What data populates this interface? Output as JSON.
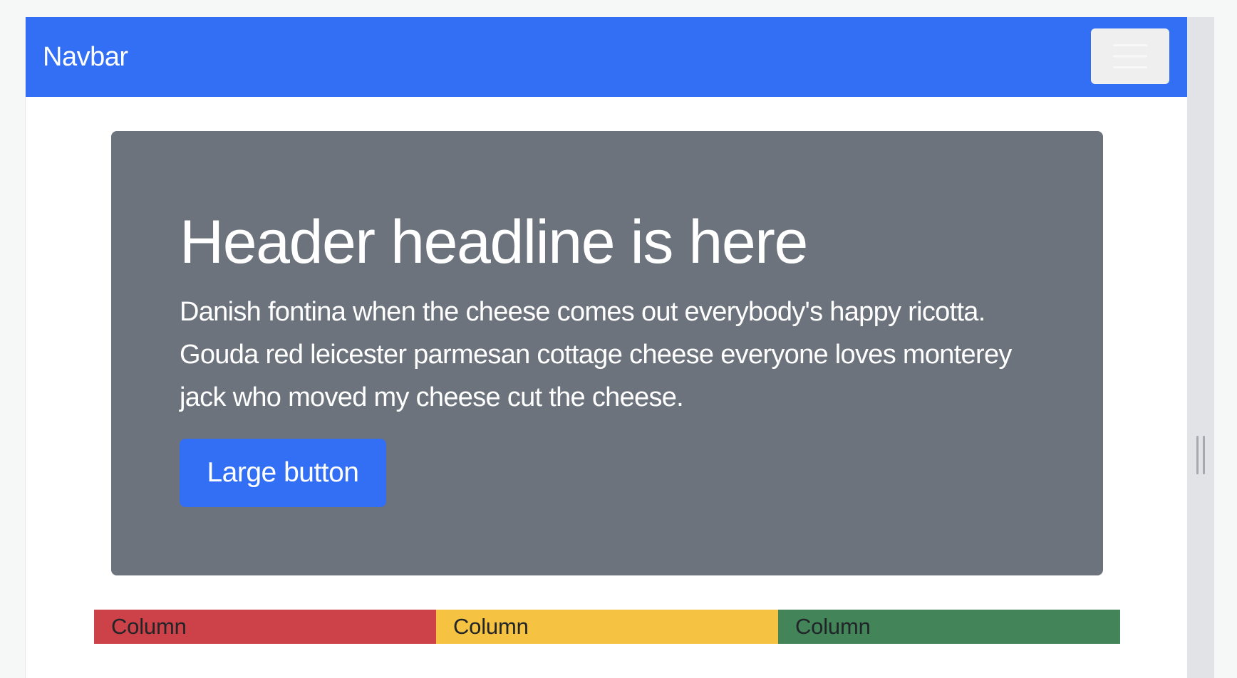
{
  "navbar": {
    "brand": "Navbar",
    "color": "#336ff5",
    "toggle_icon": "hamburger-menu-icon"
  },
  "hero": {
    "title": "Header headline is here",
    "text": "Danish fontina when the cheese comes out everybody's happy ricotta. Gouda red leicester parmesan cottage cheese everyone loves monterey jack who moved my cheese cut the cheese.",
    "button_label": "Large button",
    "background": "#6c737c"
  },
  "columns": [
    {
      "label": "Column",
      "color": "#cd4248"
    },
    {
      "label": "Column",
      "color": "#f5c242"
    },
    {
      "label": "Column",
      "color": "#448459"
    }
  ]
}
